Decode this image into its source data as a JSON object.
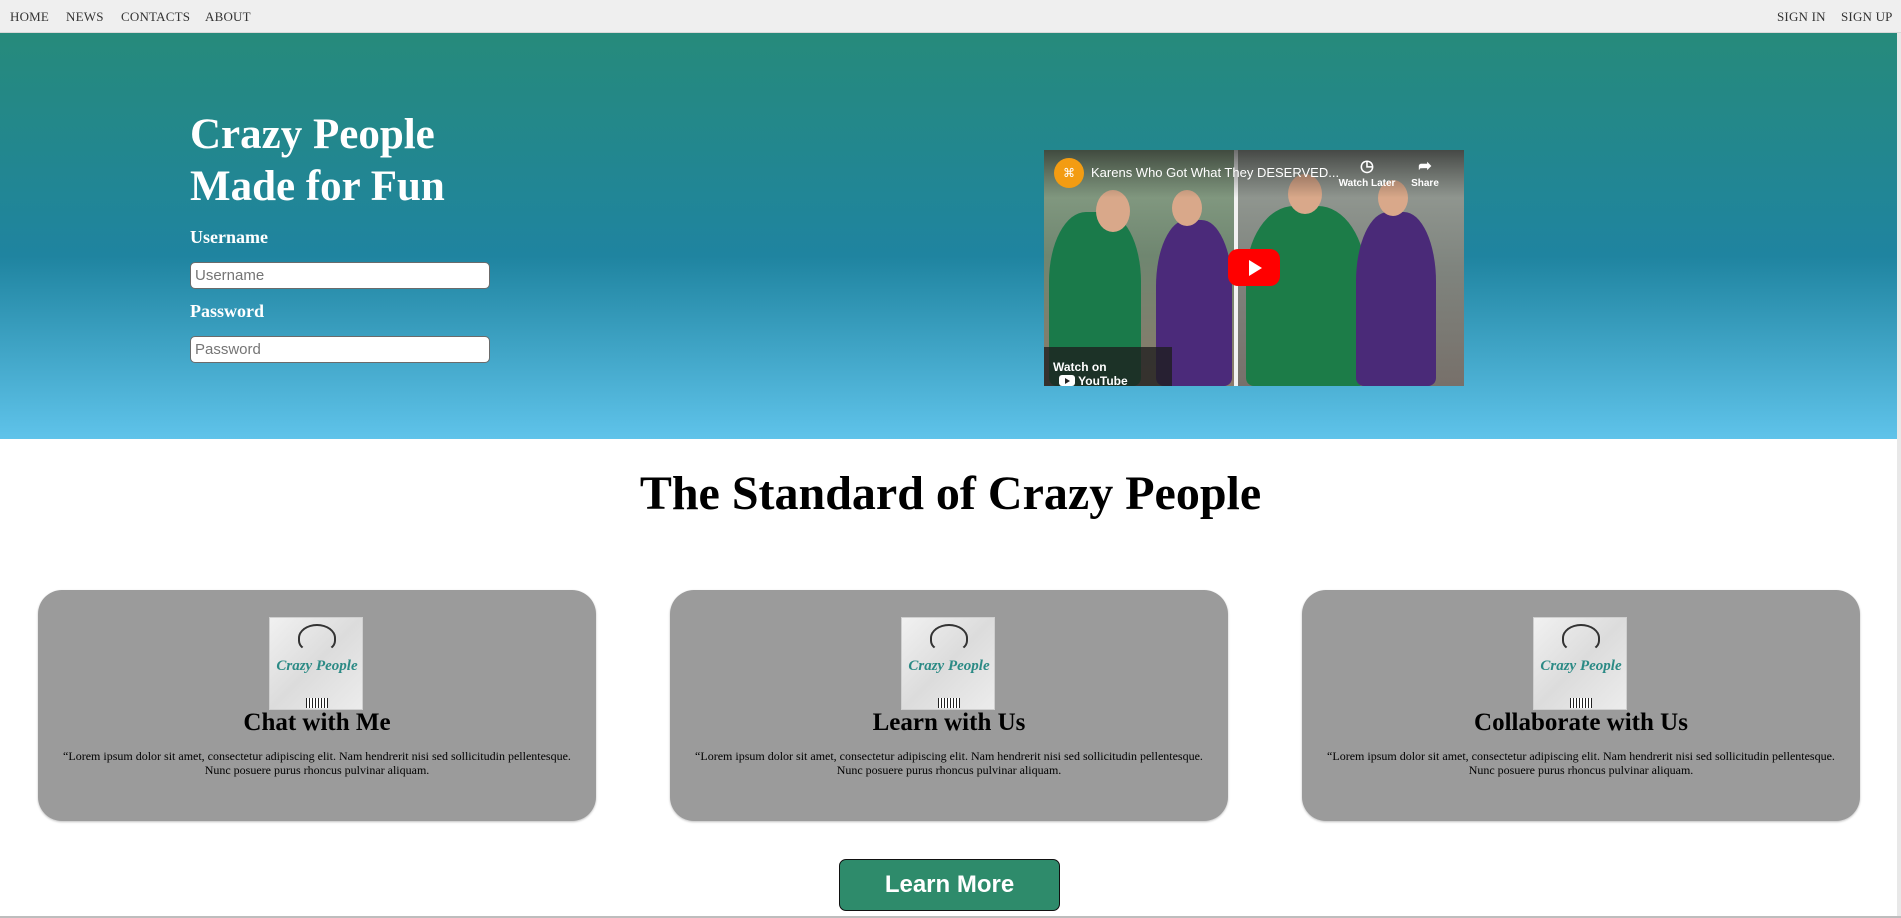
{
  "nav": {
    "left": [
      "HOME",
      "NEWS",
      "CONTACTS",
      "ABOUT"
    ],
    "right": [
      "SIGN IN",
      "SIGN UP"
    ]
  },
  "hero": {
    "title_line1": "Crazy People",
    "title_line2": "Made for Fun",
    "username_label": "Username",
    "username_placeholder": "Username",
    "password_label": "Password",
    "password_placeholder": "Password"
  },
  "video": {
    "title": "Karens Who Got What They DESERVED...",
    "watch_later": "Watch Later",
    "share": "Share",
    "watch_on": "Watch on",
    "youtube": "YouTube",
    "channel_initial": "⌘"
  },
  "section": {
    "title": "The Standard of Crazy People"
  },
  "cards": [
    {
      "logo_text": "Crazy People",
      "title": "Chat with Me",
      "text": "“Lorem ipsum dolor sit amet, consectetur adipiscing elit. Nam hendrerit nisi sed sollicitudin pellentesque. Nunc posuere purus rhoncus pulvinar aliquam."
    },
    {
      "logo_text": "Crazy People",
      "title": "Learn with Us",
      "text": "“Lorem ipsum dolor sit amet, consectetur adipiscing elit. Nam hendrerit nisi sed sollicitudin pellentesque. Nunc posuere purus rhoncus pulvinar aliquam."
    },
    {
      "logo_text": "Crazy People",
      "title": "Collaborate with Us",
      "text": "“Lorem ipsum dolor sit amet, consectetur adipiscing elit. Nam hendrerit nisi sed sollicitudin pellentesque. Nunc posuere purus rhoncus pulvinar aliquam."
    }
  ],
  "cta": {
    "label": "Learn More"
  },
  "colors": {
    "hero_top": "#268a7b",
    "hero_bottom": "#5fc3ea",
    "card_bg": "#9b9b9b",
    "cta_bg": "#2e8b6b",
    "brand_teal": "#2b8a85"
  }
}
